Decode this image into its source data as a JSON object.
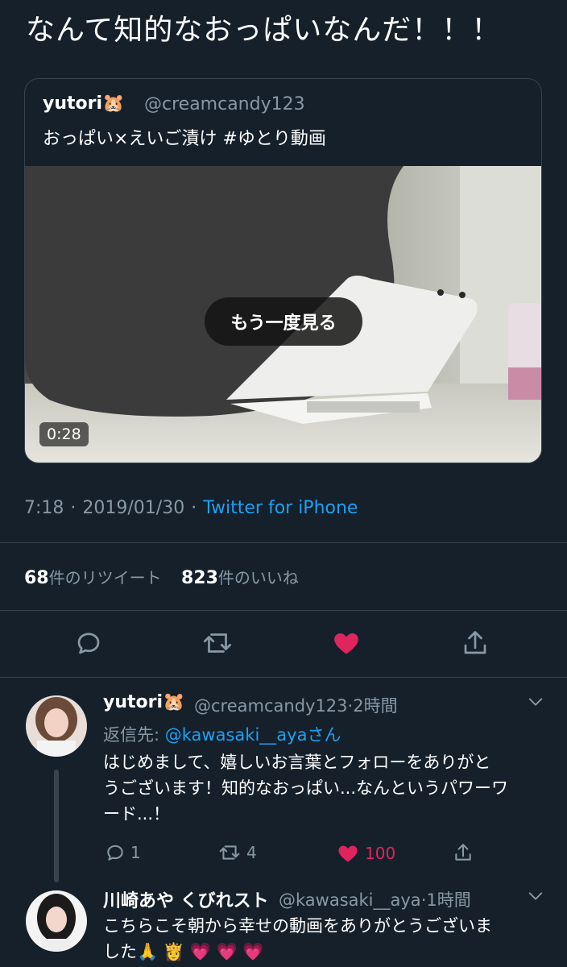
{
  "tweet": {
    "text": "なんて知的なおっぱいなんだ！！！",
    "quoted": {
      "name": "yutori🐹",
      "handle": "@creamcandy123",
      "text": "おっぱい×えいご漬け #ゆとり動画",
      "replay_label": "もう一度見る",
      "duration": "0:28"
    },
    "time": "7:18",
    "date": "2019/01/30",
    "source": "Twitter for iPhone",
    "retweet_count": "68",
    "retweet_label": "件のリツイート",
    "like_count": "823",
    "like_label": "件のいいね",
    "colors": {
      "like": "#e0245e",
      "link": "#1da1f2"
    }
  },
  "replies": [
    {
      "name": "yutori🐹",
      "handle": "@creamcandy123",
      "time": "·2時間",
      "reply_to_prefix": "返信先: ",
      "reply_to_handle": "@kawasaki__aya",
      "reply_to_suffix": "さん",
      "body_lines": [
        "はじめまして、嬉しいお言葉とフォローをありがと",
        "うございます！知的なおっぱい...なんというパワーワ",
        "ード...！"
      ],
      "reply_count": "1",
      "retweet_count": "4",
      "like_count": "100"
    },
    {
      "name": "川崎あや くびれスト",
      "handle": "@kawasaki__aya",
      "time": "·1時間",
      "body_lines": [
        "こちらこそ朝から幸せの動画をありがとうございま",
        "した🙏 👸 💗 💗 💗"
      ]
    }
  ]
}
